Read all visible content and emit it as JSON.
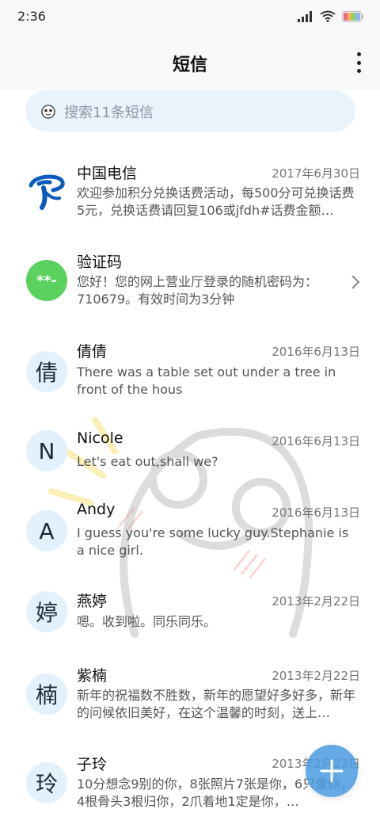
{
  "status": {
    "time": "2:36"
  },
  "header": {
    "title": "短信"
  },
  "search": {
    "placeholder": "搜索11条短信"
  },
  "messages": [
    {
      "sender": "中国电信",
      "date": "2017年6月30日",
      "preview": "欢迎参加积分兑换话费活动，每500分可兑换话费5元，兑换话费请回复106或jfdh#话费金额…",
      "avatar_icon": "china-telecom-logo"
    },
    {
      "sender": "验证码",
      "avatar_text": "**-",
      "preview": "您好！您的网上营业厅登录的随机密码为：710679。有效时间为3分钟",
      "avatar_color": "#5bd15f"
    },
    {
      "sender": "倩倩",
      "date": "2016年6月13日",
      "avatar_text": "倩",
      "preview": "There was a table set out under a tree in front of the hous"
    },
    {
      "sender": "Nicole",
      "date": "2016年6月13日",
      "avatar_text": "N",
      "preview": "Let's eat out,shall we?"
    },
    {
      "sender": "Andy",
      "date": "2016年6月13日",
      "avatar_text": "A",
      "preview": "I guess you're some lucky guy.Stephanie is a nice girl."
    },
    {
      "sender": "燕婷",
      "date": "2013年2月22日",
      "avatar_text": "婷",
      "preview": "嗯。收到啦。同乐同乐。"
    },
    {
      "sender": "紫楠",
      "date": "2013年2月22日",
      "avatar_text": "楠",
      "preview": "新年的祝福数不胜数，新年的愿望好多好多，新年的问候依旧美好，在这个温馨的时刻，送上…"
    },
    {
      "sender": "子玲",
      "date": "2013年2月22日",
      "avatar_text": "玲",
      "preview": "10分想念9别的你，8张照片7张是你，6只像你，4根骨头3根归你，2爪着地1定是你，…"
    }
  ],
  "colors": {
    "accent": "#4a9bdf",
    "avatar_bg": "#e2f1fc",
    "search_bg": "#e8f3fc"
  }
}
